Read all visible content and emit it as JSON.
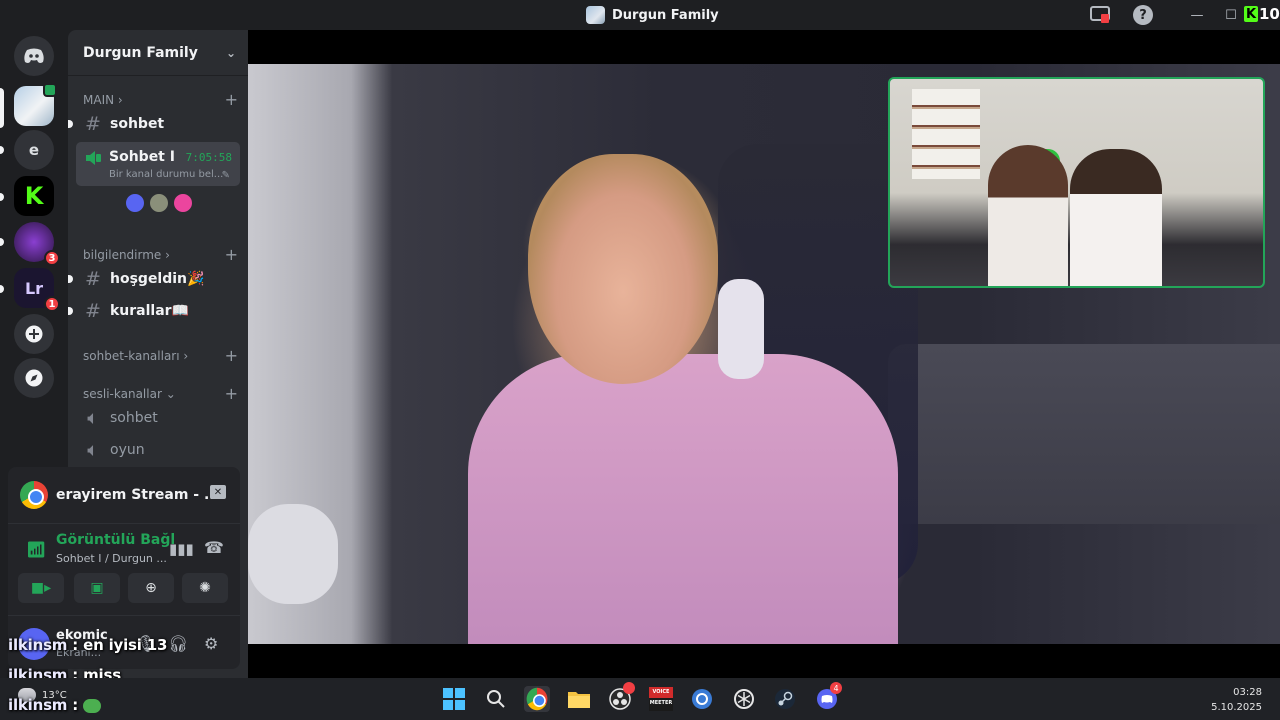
{
  "window": {
    "title": "Durgun Family",
    "kick_logo_text": "10"
  },
  "rail": {
    "home_icon": "discord-icon",
    "letter_server": "e",
    "badges": [
      "3",
      "1"
    ],
    "add_server_icon": "plus-icon",
    "discover_icon": "compass-icon"
  },
  "sidebar": {
    "server_name": "Durgun Family",
    "categories": {
      "main": "MAIN",
      "bilgilendirme": "bilgilendirme",
      "sohbet_kanallari": "sohbet-kanalları",
      "sesli_kanallar": "sesli-kanallar"
    },
    "channels": {
      "sohbet": "sohbet",
      "hosgeldin": "hoşgeldin🎉",
      "kurallar": "kurallar📖",
      "voice_sohbet": "sohbet",
      "voice_oyun": "oyun"
    },
    "active_voice": {
      "name": "Sohbet I",
      "elapsed": "7:05:58",
      "status": "Bir kanal durumu bel..."
    }
  },
  "voice_panel": {
    "stream_title": "erayirem Stream - ...",
    "connection_title": "Görüntülü Bağl",
    "connection_sub": "Sohbet I / Durgun ...",
    "user_name": "ekomic",
    "user_status": "Ekranı..."
  },
  "chat_overlay": [
    {
      "user": "ilkinsm",
      "text": " : en iyisi 13"
    },
    {
      "user": "ilkinsm",
      "text": " : miss"
    },
    {
      "user": "ilkinsm",
      "text": " : "
    }
  ],
  "taskbar": {
    "weather_temp": "13°C",
    "time": "03:28",
    "date": "5.10.2025",
    "discord_badge": "4",
    "voicemeeter_label": "VOICE MEETER"
  },
  "colors": {
    "green": "#23a559",
    "blurple": "#5865f2",
    "red": "#f23f43",
    "kick": "#53fc18"
  }
}
